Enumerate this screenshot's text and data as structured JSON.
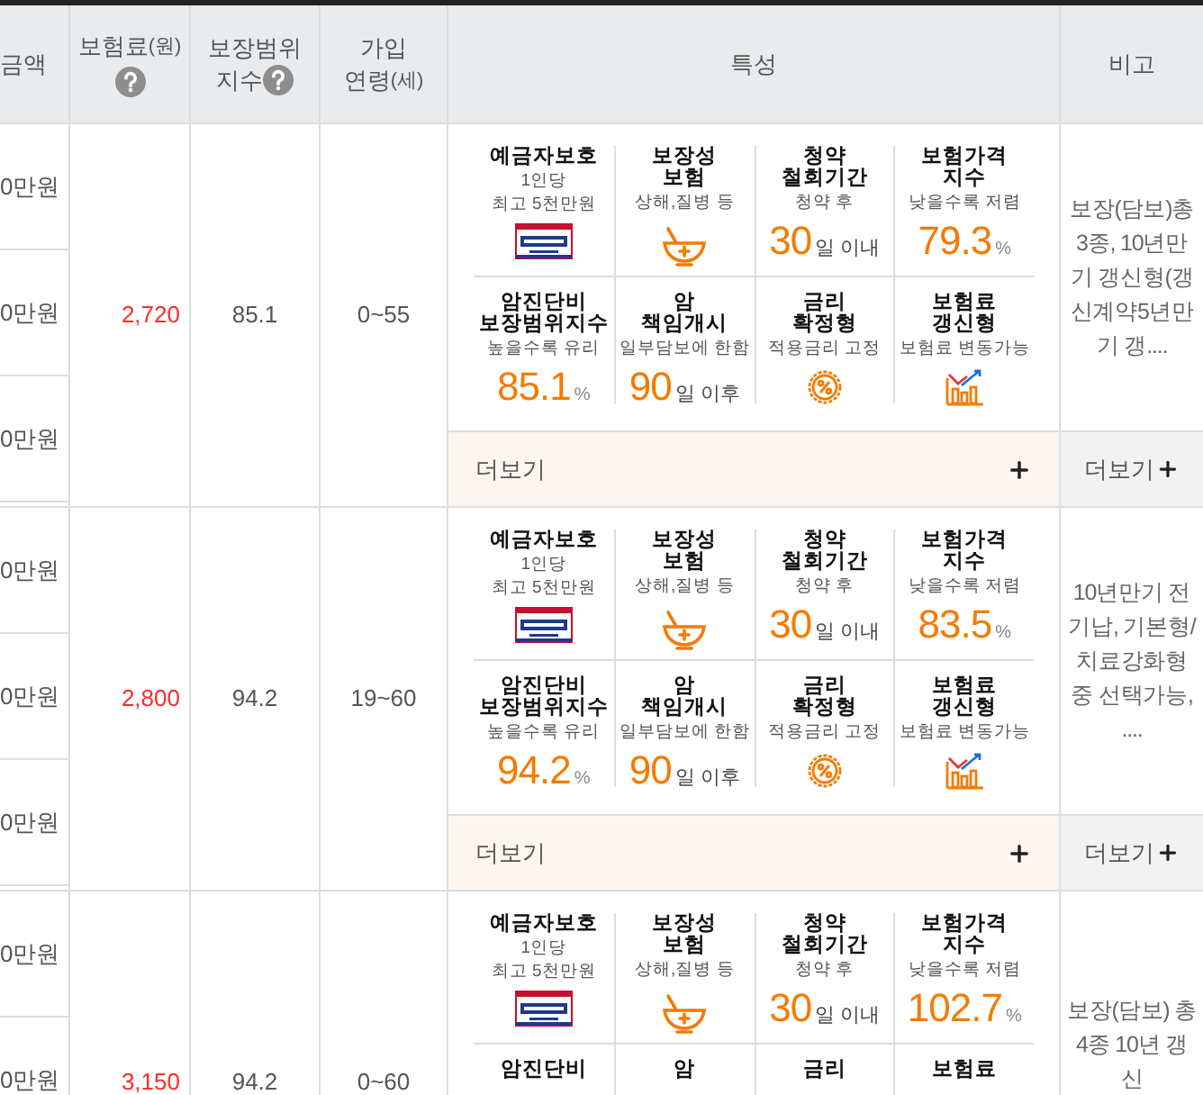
{
  "headers": [
    {
      "lines": [
        "금액"
      ]
    },
    {
      "lines": [
        "보험료"
      ],
      "unit": "(원)",
      "help": true
    },
    {
      "lines": [
        "보장범위",
        "지수"
      ],
      "help": true
    },
    {
      "lines": [
        "가입",
        "연령"
      ],
      "unit": "(세)"
    },
    {
      "lines": [
        "특성"
      ]
    },
    {
      "lines": [
        "비고"
      ]
    }
  ],
  "products": [
    {
      "amounts": [
        "0만원",
        "0만원",
        "0만원"
      ],
      "premium": "2,720",
      "index": "85.1",
      "age": "0~55",
      "features": [
        {
          "kind": "badge",
          "title": [
            "예금자보호"
          ],
          "sub": [
            "1인당",
            "최고 5천만원"
          ]
        },
        {
          "kind": "bowl",
          "title": [
            "보장성",
            "보험"
          ],
          "sub": [
            "상해,질병 등"
          ]
        },
        {
          "kind": "value",
          "title": [
            "청약",
            "철회기간"
          ],
          "sub": [
            "청약 후"
          ],
          "value": "30",
          "unit": "일 이내"
        },
        {
          "kind": "value",
          "title": [
            "보험가격",
            "지수"
          ],
          "sub": [
            "낮을수록 저렴"
          ],
          "value": "79.3",
          "unit": "%"
        },
        {
          "kind": "value",
          "title": [
            "암진단비",
            "보장범위지수"
          ],
          "sub": [
            "높을수록 유리"
          ],
          "value": "85.1",
          "unit": "%"
        },
        {
          "kind": "value",
          "title": [
            "암",
            "책임개시"
          ],
          "sub": [
            "일부담보에 한함"
          ],
          "value": "90",
          "unit": "일 이후"
        },
        {
          "kind": "rate",
          "title": [
            "금리",
            "확정형"
          ],
          "sub": [
            "적용금리 고정"
          ]
        },
        {
          "kind": "chart",
          "title": [
            "보험료",
            "갱신형"
          ],
          "sub": [
            "보험료 변동가능"
          ]
        }
      ],
      "more": "더보기",
      "note": "보장(담보)총3종, 10년만기 갱신형(갱신계약5년만기 갱....",
      "note_more": "더보기"
    },
    {
      "amounts": [
        "0만원",
        "0만원",
        "0만원"
      ],
      "premium": "2,800",
      "index": "94.2",
      "age": "19~60",
      "features": [
        {
          "kind": "badge",
          "title": [
            "예금자보호"
          ],
          "sub": [
            "1인당",
            "최고 5천만원"
          ]
        },
        {
          "kind": "bowl",
          "title": [
            "보장성",
            "보험"
          ],
          "sub": [
            "상해,질병 등"
          ]
        },
        {
          "kind": "value",
          "title": [
            "청약",
            "철회기간"
          ],
          "sub": [
            "청약 후"
          ],
          "value": "30",
          "unit": "일 이내"
        },
        {
          "kind": "value",
          "title": [
            "보험가격",
            "지수"
          ],
          "sub": [
            "낮을수록 저렴"
          ],
          "value": "83.5",
          "unit": "%"
        },
        {
          "kind": "value",
          "title": [
            "암진단비",
            "보장범위지수"
          ],
          "sub": [
            "높을수록 유리"
          ],
          "value": "94.2",
          "unit": "%"
        },
        {
          "kind": "value",
          "title": [
            "암",
            "책임개시"
          ],
          "sub": [
            "일부담보에 한함"
          ],
          "value": "90",
          "unit": "일 이후"
        },
        {
          "kind": "rate",
          "title": [
            "금리",
            "확정형"
          ],
          "sub": [
            "적용금리 고정"
          ]
        },
        {
          "kind": "chart",
          "title": [
            "보험료",
            "갱신형"
          ],
          "sub": [
            "보험료 변동가능"
          ]
        }
      ],
      "more": "더보기",
      "note": "10년만기 전기납, 기본형/치료강화형 중 선택가능, ....",
      "note_more": "더보기"
    },
    {
      "amounts": [
        "0만원",
        "0만원"
      ],
      "premium": "3,150",
      "index": "94.2",
      "age": "0~60",
      "features": [
        {
          "kind": "badge",
          "title": [
            "예금자보호"
          ],
          "sub": [
            "1인당",
            "최고 5천만원"
          ]
        },
        {
          "kind": "bowl",
          "title": [
            "보장성",
            "보험"
          ],
          "sub": [
            "상해,질병 등"
          ]
        },
        {
          "kind": "value",
          "title": [
            "청약",
            "철회기간"
          ],
          "sub": [
            "청약 후"
          ],
          "value": "30",
          "unit": "일 이내"
        },
        {
          "kind": "value",
          "title": [
            "보험가격",
            "지수"
          ],
          "sub": [
            "낮을수록 저렴"
          ],
          "value": "102.7",
          "unit": "%"
        },
        {
          "kind": "plain",
          "title": [
            "암진단비"
          ]
        },
        {
          "kind": "plain",
          "title": [
            "암"
          ]
        },
        {
          "kind": "plain",
          "title": [
            "금리"
          ]
        },
        {
          "kind": "plain",
          "title": [
            "보험료"
          ]
        }
      ],
      "note": "보장(담보) 총 4종 10년 갱신"
    }
  ]
}
